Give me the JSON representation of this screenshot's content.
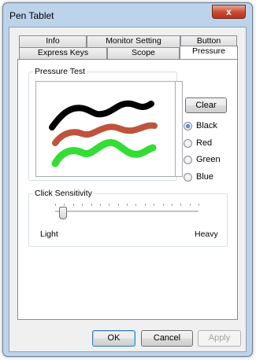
{
  "window": {
    "title": "Pen Tablet",
    "close_glyph": "x"
  },
  "tabs": {
    "row1": [
      "Info",
      "Monitor Setting",
      "Button"
    ],
    "row2": [
      "Express Keys",
      "Scope",
      "Pressure"
    ],
    "active": "Pressure"
  },
  "pressure_test": {
    "legend": "Pressure Test",
    "value": "0",
    "clear_label": "Clear",
    "colors": [
      {
        "label": "Black",
        "checked": true
      },
      {
        "label": "Red",
        "checked": false
      },
      {
        "label": "Green",
        "checked": false
      },
      {
        "label": "Blue",
        "checked": false
      }
    ],
    "stroke_colors": {
      "black": "#000000",
      "red": "#c0533c",
      "green": "#33dd33"
    }
  },
  "click_sensitivity": {
    "legend": "Click Sensitivity",
    "min_label": "Light",
    "max_label": "Heavy",
    "level": 0.05
  },
  "footer": {
    "ok_label": "OK",
    "cancel_label": "Cancel",
    "apply_label": "Apply"
  }
}
